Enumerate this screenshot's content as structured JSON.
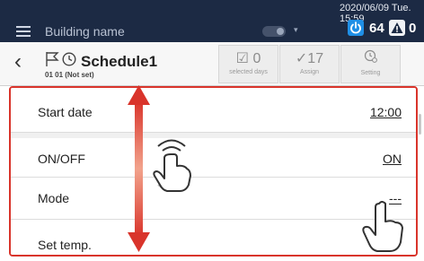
{
  "topbar": {
    "building_name": "Building name",
    "datetime": "2020/06/09 Tue. 15:59",
    "power_count": "64",
    "alert_count": "0",
    "colors": {
      "background": "#1c2a44",
      "power_badge": "#1f8fe6"
    }
  },
  "header": {
    "title": "Schedule1",
    "subtitle": "01   01   (Not set)",
    "buttons": [
      {
        "value": "0",
        "label": "selected days",
        "icon": "calendar-check-icon"
      },
      {
        "value": "17",
        "label": "Assign",
        "icon": "checkmark-icon"
      },
      {
        "value": "",
        "label": "Setting",
        "icon": "clock-gear-icon"
      }
    ]
  },
  "rows": [
    {
      "label": "Start date",
      "value": "12:00"
    },
    {
      "label": "ON/OFF",
      "value": "ON"
    },
    {
      "label": "Mode",
      "value": "---"
    },
    {
      "label": "Set temp.",
      "value": ""
    }
  ],
  "icons": [
    "menu-icon",
    "toggle-icon",
    "power-icon",
    "alert-icon",
    "back-arrow-icon",
    "flag-icon",
    "clock-icon",
    "scroll-arrow-icon",
    "swipe-hand-icon",
    "tap-hand-icon"
  ],
  "highlight_color": "#d9342b"
}
